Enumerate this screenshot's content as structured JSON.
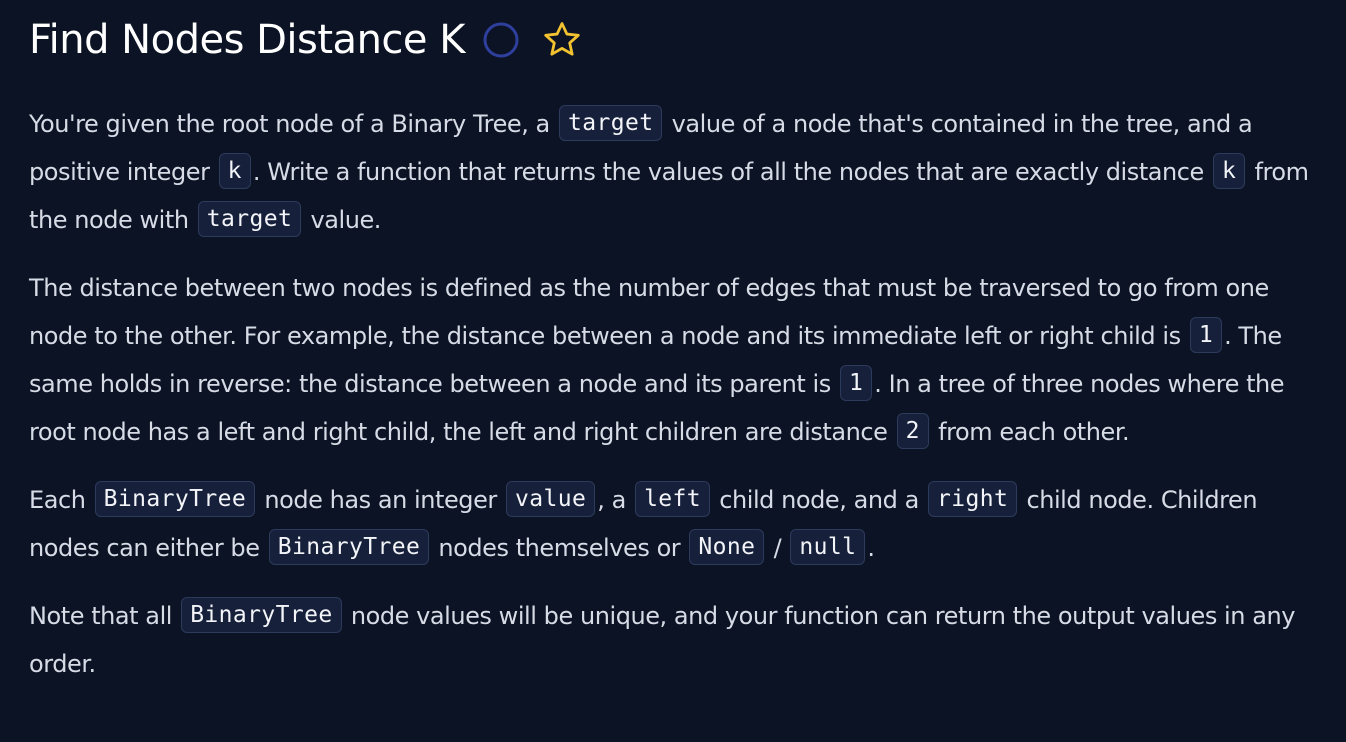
{
  "header": {
    "title": "Find Nodes Distance K"
  },
  "icons": {
    "status": "circle-outline-icon",
    "favorite": "star-outline-icon"
  },
  "colors": {
    "background": "#0b1324",
    "text": "#d6dbe6",
    "title": "#ffffff",
    "code_bg": "#16203a",
    "code_border": "#2c3a5c",
    "circle_outline": "#2e3f9e",
    "star_outline": "#f2c230"
  },
  "p1": {
    "t1": "You're given the root node of a Binary Tree, a ",
    "c1": "target",
    "t2": " value of a node that's contained in the tree, and a positive integer ",
    "c2": "k",
    "t3": ". Write a function that returns the values of all the nodes that are exactly distance ",
    "c3": "k",
    "t4": " from the node with ",
    "c4": "target",
    "t5": " value."
  },
  "p2": {
    "t1": "The distance between two nodes is defined as the number of edges that must be traversed to go from one node to the other. For example, the distance between a node and its immediate left or right child is ",
    "c1": "1",
    "t2": ". The same holds in reverse: the distance between a node and its parent is ",
    "c2": "1",
    "t3": ". In a tree of three nodes where the root node has a left and right child, the left and right children are distance ",
    "c3": "2",
    "t4": " from each other."
  },
  "p3": {
    "t1": "Each ",
    "c1": "BinaryTree",
    "t2": " node has an integer ",
    "c2": "value",
    "t3": ", a ",
    "c3": "left",
    "t4": " child node, and a ",
    "c4": "right",
    "t5": " child node. Children nodes can either be ",
    "c5": "BinaryTree",
    "t6": " nodes themselves or ",
    "c6": "None",
    "t7": " / ",
    "c7": "null",
    "t8": "."
  },
  "p4": {
    "t1": "Note that all ",
    "c1": "BinaryTree",
    "t2": " node values will be unique, and your function can return the output values in any order."
  }
}
